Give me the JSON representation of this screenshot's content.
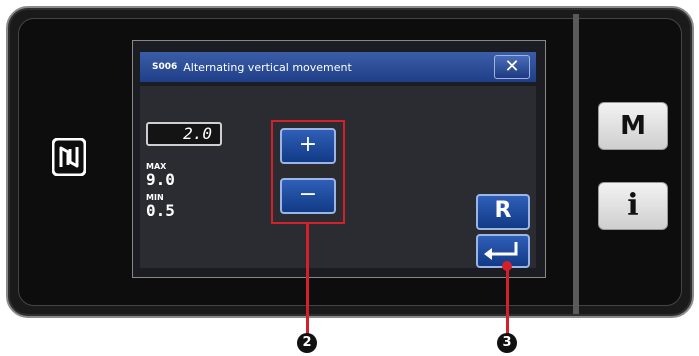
{
  "dialog": {
    "code": "S006",
    "title": "Alternating vertical movement",
    "close_label": "✕"
  },
  "value": {
    "current": "2.0",
    "max_label": "MAX",
    "max_value": "9.0",
    "min_label": "MIN",
    "min_value": "0.5"
  },
  "buttons": {
    "plus_label": "+",
    "minus_label": "−",
    "reset_label": "R",
    "menu_label": "M",
    "info_label": "i"
  },
  "callouts": {
    "plus_minus": "2",
    "enter": "3"
  },
  "colors": {
    "accent_blue": "#1f3f88",
    "callout_red": "#d4202a"
  }
}
